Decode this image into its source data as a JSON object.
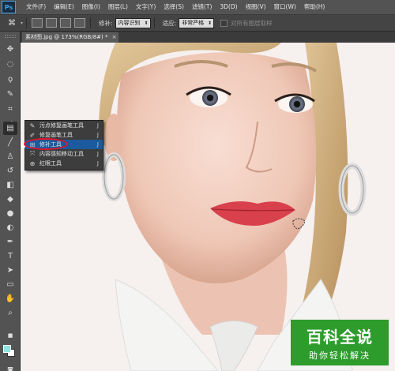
{
  "app": {
    "logo": "Ps"
  },
  "menubar": {
    "items": [
      "文件(F)",
      "编辑(E)",
      "图像(I)",
      "图层(L)",
      "文字(Y)",
      "选择(S)",
      "滤镜(T)",
      "3D(D)",
      "视图(V)",
      "窗口(W)",
      "帮助(H)"
    ]
  },
  "options": {
    "repair_label": "修补:",
    "repair_value": "内容识别",
    "adapt_label": "适应:",
    "adapt_value": "非常严格",
    "sample_all_label": "对所有图层取样"
  },
  "document": {
    "tab_title": "素材图.jpg @ 173%(RGB/8#) *"
  },
  "flyout": {
    "items": [
      {
        "label": "污点修复画笔工具",
        "shortcut": "J",
        "icon": "spot-healing-brush-icon"
      },
      {
        "label": "修复画笔工具",
        "shortcut": "J",
        "icon": "healing-brush-icon"
      },
      {
        "label": "修补工具",
        "shortcut": "J",
        "icon": "patch-icon"
      },
      {
        "label": "内容感知移动工具",
        "shortcut": "J",
        "icon": "content-aware-move-icon"
      },
      {
        "label": "红眼工具",
        "shortcut": "J",
        "icon": "red-eye-icon"
      }
    ]
  },
  "colors": {
    "foreground": "#8ee6df",
    "background": "#ffffff",
    "selection_highlight": "#1b5a9c",
    "annotation_ring": "#e0152d",
    "watermark_bg": "#2d9c2d"
  },
  "watermark": {
    "title": "百科全说",
    "subtitle": "助你轻松解决"
  }
}
